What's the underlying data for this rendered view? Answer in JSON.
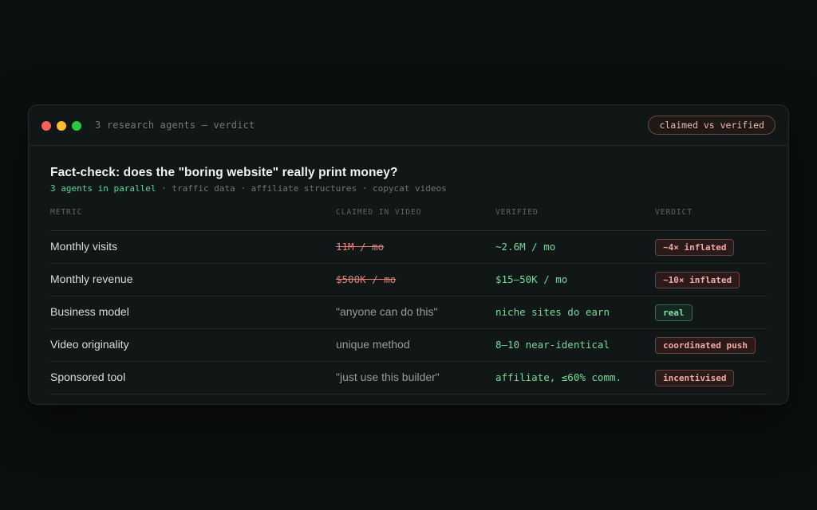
{
  "window": {
    "title": "3 research agents — verdict",
    "badge": "claimed vs verified"
  },
  "report": {
    "heading": "Fact-check: does the \"boring website\" really print money?",
    "subtitle_accent": "3 agents in parallel",
    "subtitle_rest": " · traffic data · affiliate structures · copycat videos"
  },
  "table": {
    "headers": [
      "METRIC",
      "CLAIMED IN VIDEO",
      "VERIFIED",
      "VERDICT"
    ],
    "rows": [
      {
        "metric": "Monthly visits",
        "claimed": "11M / mo",
        "verified": "~2.6M / mo",
        "verdict": "~4× inflated"
      },
      {
        "metric": "Monthly revenue",
        "claimed": "$500K / mo",
        "verified": "$15–50K / mo",
        "verdict": "~10× inflated"
      },
      {
        "metric": "Business model",
        "claimed": "\"anyone can do this\"",
        "verified": "niche sites do earn",
        "verdict": "real"
      },
      {
        "metric": "Video originality",
        "claimed": "unique method",
        "verified": "8–10 near-identical",
        "verdict": "coordinated push"
      },
      {
        "metric": "Sponsored tool",
        "claimed": "\"just use this builder\"",
        "verified": "affiliate, ≤60% comm.",
        "verdict": "incentivised"
      }
    ]
  },
  "colors": {
    "accent": "#56d6a0",
    "bad": "#f0aaa3",
    "good": "#7fe3a8",
    "strike": "#e0827c"
  }
}
